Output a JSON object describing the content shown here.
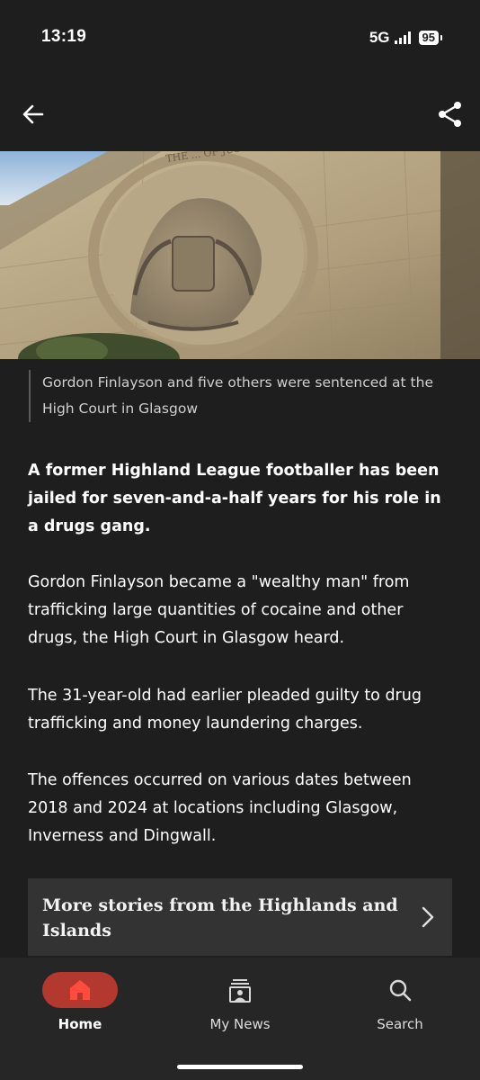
{
  "status": {
    "time": "13:19",
    "network": "5G",
    "battery": "95"
  },
  "topbar": {
    "back_icon": "arrow-left-icon",
    "share_icon": "share-icon"
  },
  "hero": {
    "inscription": "THE ... OF JUSTICE"
  },
  "caption": "Gordon Finlayson and five others were sentenced at the High Court in Glasgow",
  "article": {
    "lead": "A former Highland League footballer has been jailed for seven-and-a-half years for his role in a drugs gang.",
    "paragraphs": [
      "Gordon Finlayson became a \"wealthy man\" from trafficking large quantities of cocaine and other drugs, the High Court in Glasgow heard.",
      "The 31-year-old had earlier pleaded guilty to drug trafficking and money laundering charges.",
      "The offences occurred on various dates between 2018 and 2024 at locations including Glasgow, Inverness and Dingwall."
    ]
  },
  "more_stories": {
    "label": "More stories from the Highlands and Islands"
  },
  "nav": {
    "items": [
      {
        "label": "Home",
        "icon": "home-icon",
        "active": true
      },
      {
        "label": "My News",
        "icon": "my-news-icon",
        "active": false
      },
      {
        "label": "Search",
        "icon": "search-icon",
        "active": false
      }
    ]
  },
  "colors": {
    "background": "#1e1e1e",
    "nav_background": "#262626",
    "accent": "#b3382e",
    "panel": "#333333"
  }
}
